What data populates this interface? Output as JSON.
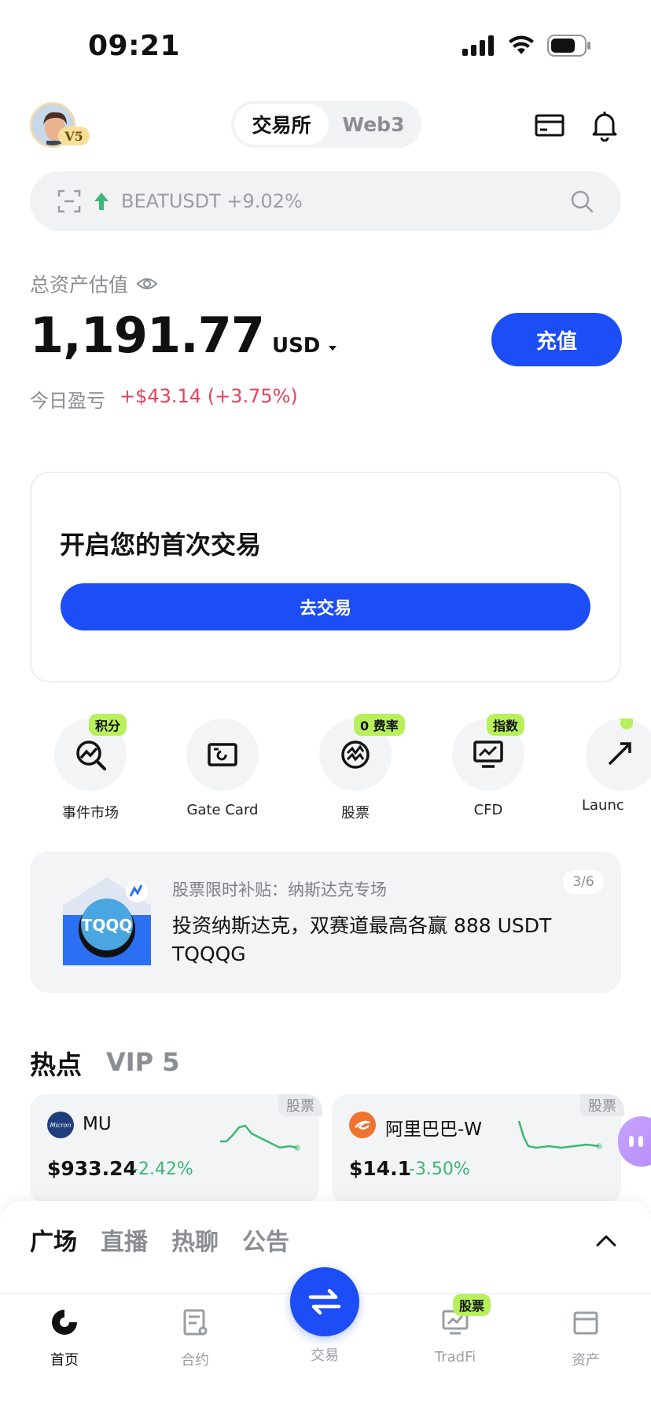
{
  "status_bar": {
    "time": "09:21"
  },
  "header": {
    "vip_badge": "V5",
    "segments": [
      "交易所",
      "Web3"
    ]
  },
  "search": {
    "ticker": "BEATUSDT +9.02%"
  },
  "assets": {
    "label": "总资产估值",
    "balance": "1,191.77",
    "currency": "USD",
    "deposit_label": "充值",
    "pnl_label": "今日盈亏",
    "pnl_value": "+$43.14 (+3.75%)"
  },
  "first_trade": {
    "title": "开启您的首次交易",
    "button": "去交易"
  },
  "shortcuts": [
    {
      "label": "事件市场",
      "tag": "积分",
      "icon": "event-market-icon"
    },
    {
      "label": "Gate Card",
      "tag": "",
      "icon": "card-icon"
    },
    {
      "label": "股票",
      "tag": "0 费率",
      "icon": "stocks-icon"
    },
    {
      "label": "CFD",
      "tag": "指数",
      "icon": "cfd-icon"
    },
    {
      "label": "Launc",
      "tag": "",
      "icon": "launchpad-icon"
    }
  ],
  "banner": {
    "subtitle": "股票限时补贴：纳斯达克专场",
    "main": "投资纳斯达克，双赛道最高各赢 888 USDT TQQQG",
    "page": "3/6",
    "logo_text": "TQQQ"
  },
  "hot": {
    "title": "热点",
    "vip": "VIP 5",
    "cards": [
      {
        "name": "MU",
        "tag": "股票",
        "price": "$933.24",
        "change": "-2.42%",
        "logo_text": "Micron",
        "logo_color": "#1f3f7a"
      },
      {
        "name": "阿里巴巴-W",
        "tag": "股票",
        "price": "$14.1",
        "change": "-3.50%",
        "logo_text": "",
        "logo_color": "#f07330"
      }
    ]
  },
  "sheet": {
    "tabs": [
      "广场",
      "直播",
      "热聊",
      "公告"
    ]
  },
  "nav": {
    "items": [
      "首页",
      "合约",
      "交易",
      "TradFi",
      "资产"
    ],
    "tradfi_tag": "股票"
  },
  "colors": {
    "accent": "#1c4df5",
    "up": "#3cb774",
    "pnl": "#e8415b",
    "tag": "#b7f05a"
  }
}
